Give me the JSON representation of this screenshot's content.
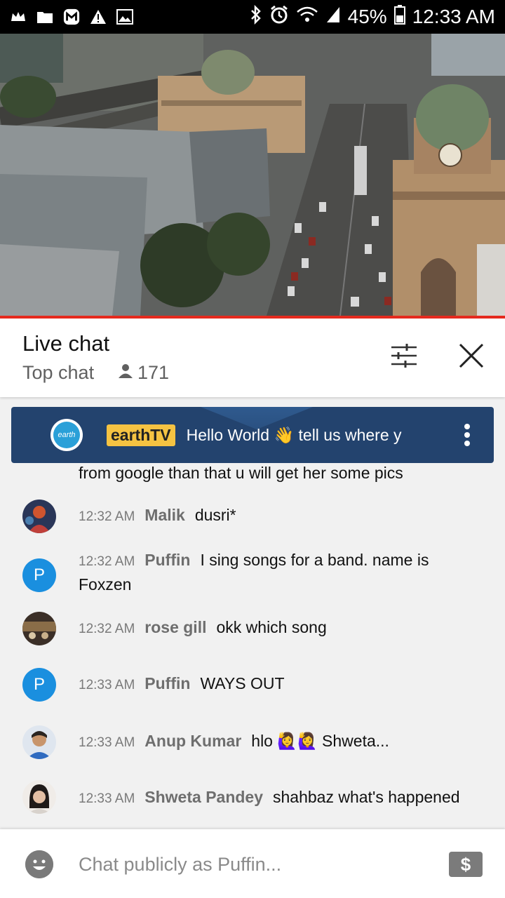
{
  "status_bar": {
    "battery": "45%",
    "time": "12:33 AM",
    "icons": [
      "crown-icon",
      "folder-icon",
      "m-app-icon",
      "warning-icon",
      "image-icon",
      "bluetooth-icon",
      "alarm-icon",
      "wifi-icon",
      "signal-icon",
      "battery-icon"
    ]
  },
  "chat": {
    "title": "Live chat",
    "mode": "Top chat",
    "viewers": "171"
  },
  "pinned": {
    "avatar_text": "earth",
    "author": "earthTV",
    "text": "Hello World 👋 tell us where y"
  },
  "messages": [
    {
      "time": "",
      "author": "",
      "text": "from google than that u will get her some pics"
    },
    {
      "time": "12:32 AM",
      "author": "Malik",
      "text": "dusri*"
    },
    {
      "time": "12:32 AM",
      "author": "Puffin",
      "text": "I sing songs for a band. name is Foxzen",
      "avatar_letter": "P"
    },
    {
      "time": "12:32 AM",
      "author": "rose gill",
      "text": "okk which song"
    },
    {
      "time": "12:33 AM",
      "author": "Puffin",
      "text": "WAYS OUT",
      "avatar_letter": "P"
    },
    {
      "time": "12:33 AM",
      "author": "Anup Kumar",
      "text": "hlo 🙋‍♀️🙋‍♀️ Shweta..."
    },
    {
      "time": "12:33 AM",
      "author": "Shweta Pandey",
      "text": "shahbaz what's happened"
    }
  ],
  "input": {
    "placeholder": "Chat publicly as Puffin...",
    "super_chat_symbol": "$"
  },
  "colors": {
    "accent_red": "#e52a1e",
    "pinned_bg": "#23436e",
    "badge_yellow": "#f5c342",
    "avatar_blue": "#1a8fdf"
  }
}
